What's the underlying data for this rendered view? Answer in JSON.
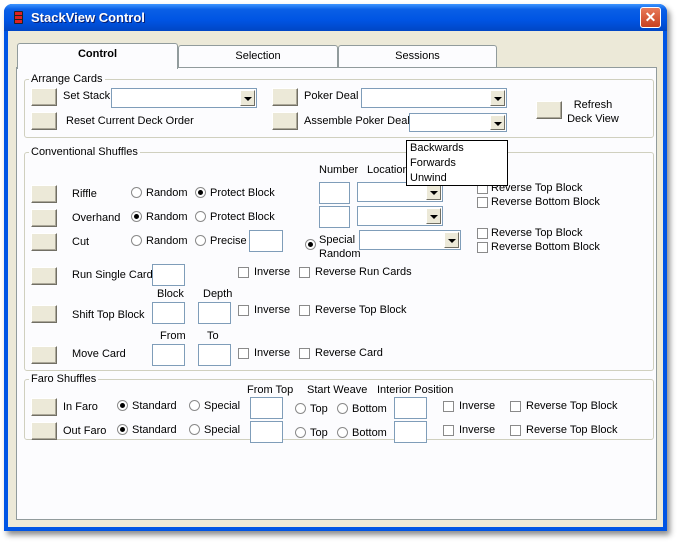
{
  "window": {
    "title": "StackView Control",
    "close": "✕"
  },
  "tabs": [
    "Control",
    "Selection",
    "Sessions"
  ],
  "arrange": {
    "legend": "Arrange Cards",
    "set_stack": "Set Stack",
    "reset": "Reset Current Deck Order",
    "poker_deal": "Poker Deal",
    "assemble": "Assemble Poker Deal",
    "refresh": "Refresh Deck View",
    "dropdown_options": [
      "Backwards",
      "Forwards",
      "Unwind"
    ]
  },
  "conv": {
    "legend": "Conventional Shuffles",
    "number": "Number",
    "location": "Location",
    "riffle": "Riffle",
    "overhand": "Overhand",
    "cut": "Cut",
    "random": "Random",
    "protect_block": "Protect Block",
    "precise": "Precise",
    "special_random": "Special Random",
    "reverse_top_block": "Reverse Top Block",
    "reverse_bottom_block": "Reverse Bottom Block",
    "run_single": "Run Single Cards",
    "inverse": "Inverse",
    "reverse_run": "Reverse Run Cards",
    "block": "Block",
    "depth": "Depth",
    "shift_top": "Shift Top Block",
    "from": "From",
    "to": "To",
    "move_card": "Move Card",
    "reverse_card": "Reverse Card"
  },
  "faro": {
    "legend": "Faro Shuffles",
    "in_faro": "In Faro",
    "out_faro": "Out Faro",
    "standard": "Standard",
    "special": "Special",
    "from_top": "From Top",
    "start_weave": "Start Weave",
    "interior": "Interior Position",
    "top": "Top",
    "bottom": "Bottom",
    "inverse": "Inverse",
    "reverse_top_block": "Reverse Top Block"
  }
}
